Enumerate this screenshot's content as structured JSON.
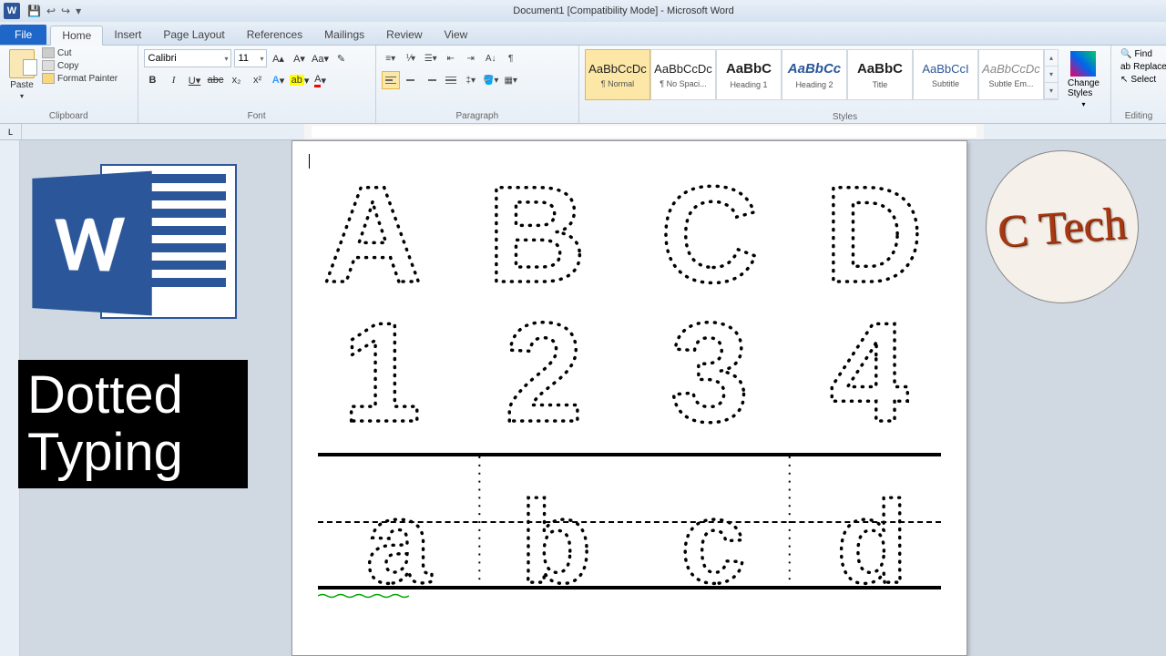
{
  "titlebar": {
    "title": "Document1 [Compatibility Mode] - Microsoft Word"
  },
  "tabs": {
    "file": "File",
    "home": "Home",
    "insert": "Insert",
    "page_layout": "Page Layout",
    "references": "References",
    "mailings": "Mailings",
    "review": "Review",
    "view": "View"
  },
  "clipboard": {
    "paste": "Paste",
    "cut": "Cut",
    "copy": "Copy",
    "format_painter": "Format Painter",
    "label": "Clipboard"
  },
  "font": {
    "name": "Calibri",
    "size": "11",
    "label": "Font"
  },
  "paragraph": {
    "label": "Paragraph"
  },
  "styles": {
    "label": "Styles",
    "items": [
      {
        "preview": "AaBbCcDc",
        "name": "¶ Normal"
      },
      {
        "preview": "AaBbCcDc",
        "name": "¶ No Spaci..."
      },
      {
        "preview": "AaBbC",
        "name": "Heading 1"
      },
      {
        "preview": "AaBbCc",
        "name": "Heading 2"
      },
      {
        "preview": "AaBbC",
        "name": "Title"
      },
      {
        "preview": "AaBbCcI",
        "name": "Subtitle"
      },
      {
        "preview": "AaBbCcDc",
        "name": "Subtle Em..."
      }
    ],
    "change": "Change Styles"
  },
  "editing": {
    "find": "Find",
    "replace": "Replace",
    "select": "Select",
    "label": "Editing"
  },
  "document": {
    "row1": [
      "A",
      "B",
      "C",
      "D"
    ],
    "row2": [
      "1",
      "2",
      "3",
      "4"
    ],
    "row3": [
      "a",
      "b",
      "c",
      "d"
    ]
  },
  "banner": {
    "line1": "Dotted",
    "line2": "Typing"
  },
  "channel": {
    "text": "C Tech"
  }
}
